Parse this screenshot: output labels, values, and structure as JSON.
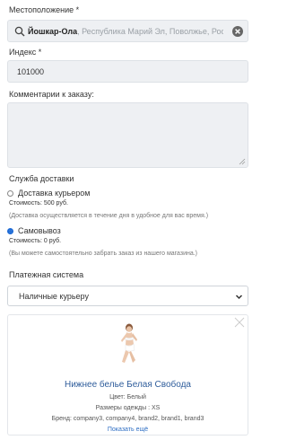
{
  "location": {
    "label": "Местоположение",
    "required_mark": "*",
    "city": "Йошкар-Ола",
    "details": ", Республика Марий Эл, Поволжье, Росси"
  },
  "index": {
    "label": "Индекс",
    "required_mark": "*",
    "value": "101000"
  },
  "comments": {
    "label": "Комментарии к заказу:",
    "value": ""
  },
  "delivery": {
    "title": "Служба доставки",
    "options": [
      {
        "label": "Доставка курьером",
        "cost": "Стоимость: 500 руб.",
        "note": "(Доставка осуществляется в течение дня в удобное для вас время.)",
        "selected": false
      },
      {
        "label": "Самовывоз",
        "cost": "Стоимость: 0 руб.",
        "note": "(Вы можете самостоятельно забрать заказ из нашего магазина.)",
        "selected": true
      }
    ]
  },
  "payment": {
    "title": "Платежная система",
    "selected": "Наличные курьеру"
  },
  "product": {
    "name": "Нижнее белье Белая Свобода",
    "color": "Цвет: Белый",
    "sizes": "Размеры одежды : XS",
    "brand": "Бренд: company3, company4, brand2, brand1, brand3",
    "more_link": "Показать ещё"
  },
  "icons": {
    "search": "search-icon",
    "clear": "clear-circle-icon",
    "chevron": "chevron-down-icon",
    "close": "close-icon"
  },
  "colors": {
    "accent": "#1e6bd6",
    "link": "#2f5d9b",
    "field_bg": "#eef0f3"
  }
}
